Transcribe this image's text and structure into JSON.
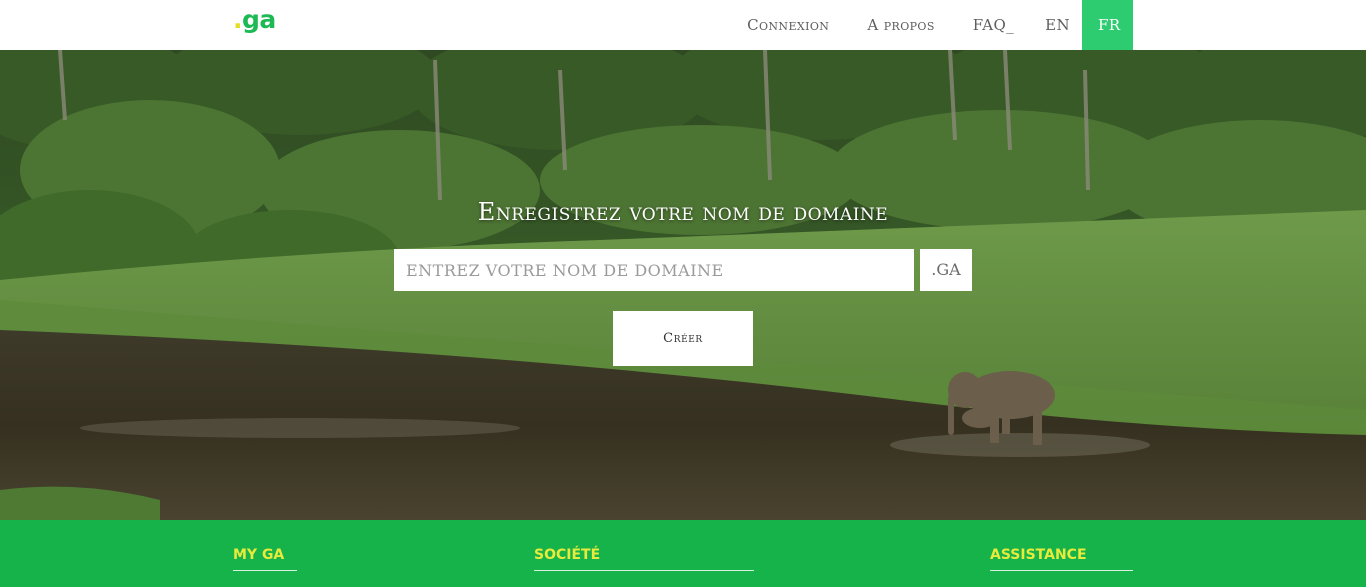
{
  "header": {
    "logo_dot": ".",
    "logo_text": "ga",
    "nav": [
      {
        "label": "Connexion"
      },
      {
        "label": "A propos"
      },
      {
        "label": "FAQ_"
      },
      {
        "label": "EN"
      },
      {
        "label": "FR"
      }
    ]
  },
  "hero": {
    "title": "Enregistrez votre nom de domaine",
    "search": {
      "placeholder": "ENTREZ VOTRE NOM DE DOMAINE",
      "value": ""
    },
    "tld": ".GA",
    "create_label": "Créer"
  },
  "footer": {
    "columns": [
      {
        "title": "MY GA"
      },
      {
        "title": "SOCIÉTÉ"
      },
      {
        "title": "ASSISTANCE"
      }
    ]
  },
  "colors": {
    "brand_green": "#2ecc71",
    "footer_green": "#16b34a",
    "footer_heading": "#e8ea3c"
  }
}
